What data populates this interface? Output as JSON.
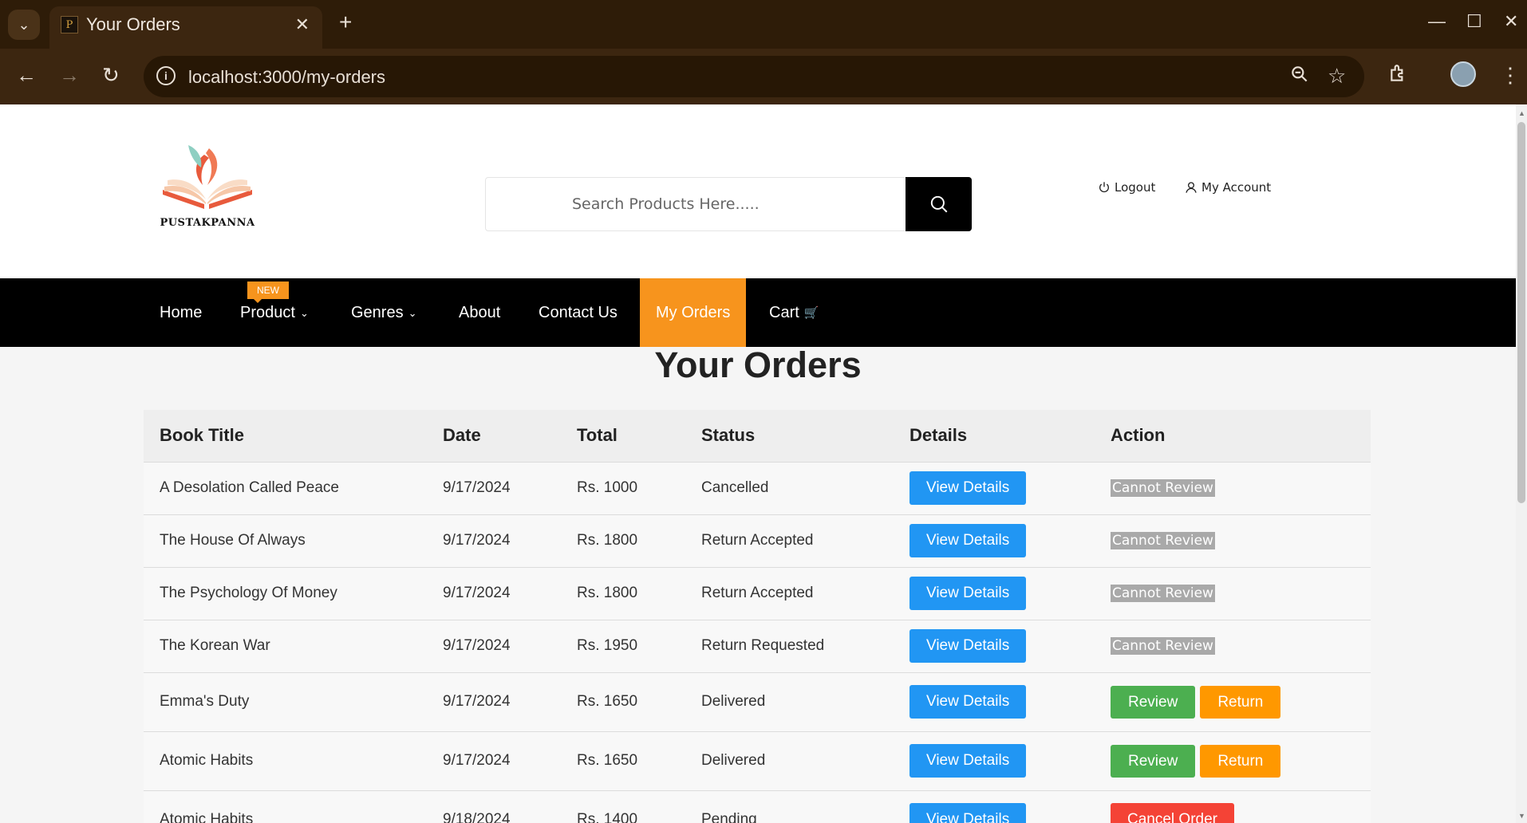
{
  "browser": {
    "tab_title": "Your Orders",
    "tab_favicon_letter": "P",
    "url": "localhost:3000/my-orders"
  },
  "header": {
    "logo_text": "PUSTAKPANNA",
    "search_placeholder": "Search Products Here.....",
    "logout_label": "Logout",
    "account_label": "My Account"
  },
  "nav": {
    "items": [
      "Home",
      "Product",
      "Genres",
      "About",
      "Contact Us",
      "My Orders",
      "Cart"
    ],
    "badge": "NEW",
    "active": "My Orders",
    "accent_color": "#f7941d"
  },
  "page": {
    "title": "Your Orders"
  },
  "table": {
    "headers": [
      "Book Title",
      "Date",
      "Total",
      "Status",
      "Details",
      "Action"
    ],
    "details_label": "View Details",
    "rows": [
      {
        "title": "A Desolation Called Peace",
        "date": "9/17/2024",
        "total": "Rs. 1000",
        "status": "Cancelled",
        "action": "Cannot Review"
      },
      {
        "title": "The House Of Always",
        "date": "9/17/2024",
        "total": "Rs. 1800",
        "status": "Return Accepted",
        "action": "Cannot Review"
      },
      {
        "title": "The Psychology Of Money",
        "date": "9/17/2024",
        "total": "Rs. 1800",
        "status": "Return Accepted",
        "action": "Cannot Review"
      },
      {
        "title": "The Korean War",
        "date": "9/17/2024",
        "total": "Rs. 1950",
        "status": "Return Requested",
        "action": "Cannot Review"
      },
      {
        "title": "Emma's Duty",
        "date": "9/17/2024",
        "total": "Rs. 1650",
        "status": "Delivered",
        "action_primary": "Review",
        "action_secondary": "Return"
      },
      {
        "title": "Atomic Habits",
        "date": "9/17/2024",
        "total": "Rs. 1650",
        "status": "Delivered",
        "action_primary": "Review",
        "action_secondary": "Return"
      },
      {
        "title": "Atomic Habits",
        "date": "9/18/2024",
        "total": "Rs. 1400",
        "status": "Pending",
        "action": "Cancel Order"
      }
    ]
  }
}
